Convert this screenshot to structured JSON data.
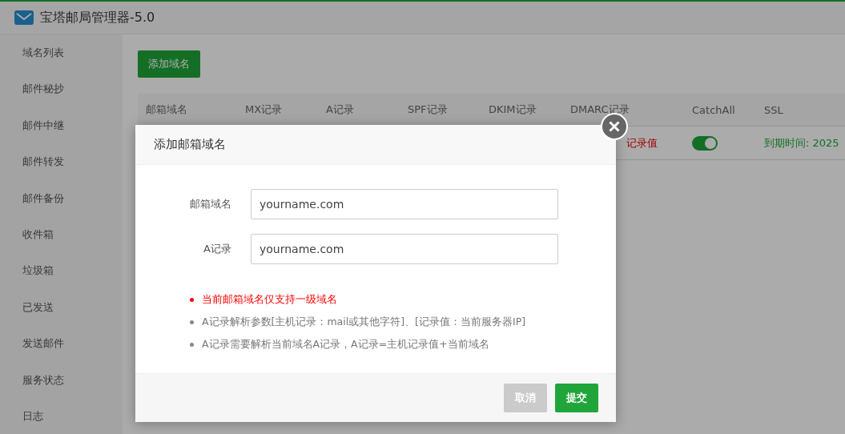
{
  "window": {
    "title": "宝塔邮局管理器-5.0"
  },
  "sidebar": {
    "items": [
      "域名列表",
      "邮件秘抄",
      "邮件中继",
      "邮件转发",
      "邮件备份",
      "收件箱",
      "垃圾箱",
      "已发送",
      "发送邮件",
      "服务状态",
      "日志"
    ]
  },
  "add_button": "添加域名",
  "table": {
    "columns": [
      "邮箱域名",
      "MX记录",
      "A记录",
      "SPF记录",
      "DKIM记录",
      "DMARC记录",
      "CatchAll",
      "SSL"
    ],
    "rows": [
      {
        "dmarc": "记录值",
        "catchall_on": true,
        "ssl": "到期时间: 2025"
      }
    ]
  },
  "dialog": {
    "title": "添加邮箱域名",
    "fields": [
      {
        "label": "邮箱域名",
        "placeholder": "yourname.com"
      },
      {
        "label": "A记录",
        "placeholder": "yourname.com"
      }
    ],
    "notes": [
      {
        "text": "当前邮箱域名仅支持一级域名",
        "kind": "warning"
      },
      {
        "text": "A记录解析参数[主机记录：mail或其他字符]、[记录值：当前服务器IP]",
        "kind": "info"
      },
      {
        "text": "A记录需要解析当前域名A记录，A记录=主机记录值+当前域名",
        "kind": "info"
      }
    ],
    "buttons": [
      {
        "label": "取消",
        "kind": "cancel"
      },
      {
        "label": "提交",
        "kind": "submit"
      }
    ]
  }
}
